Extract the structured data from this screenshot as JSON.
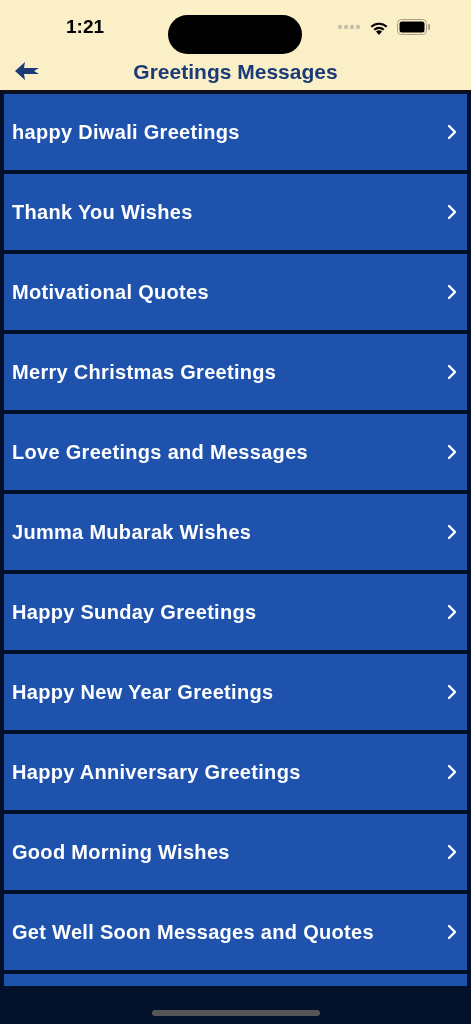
{
  "status_bar": {
    "time": "1:21"
  },
  "nav": {
    "title": "Greetings Messages"
  },
  "items": [
    {
      "label": "happy Diwali Greetings"
    },
    {
      "label": "Thank You Wishes"
    },
    {
      "label": "Motivational Quotes"
    },
    {
      "label": "Merry Christmas Greetings"
    },
    {
      "label": "Love Greetings and Messages"
    },
    {
      "label": "Jumma Mubarak Wishes"
    },
    {
      "label": "Happy Sunday Greetings"
    },
    {
      "label": "Happy New Year Greetings"
    },
    {
      "label": "Happy Anniversary Greetings"
    },
    {
      "label": "Good Morning Wishes"
    },
    {
      "label": "Get Well Soon Messages and Quotes"
    }
  ]
}
